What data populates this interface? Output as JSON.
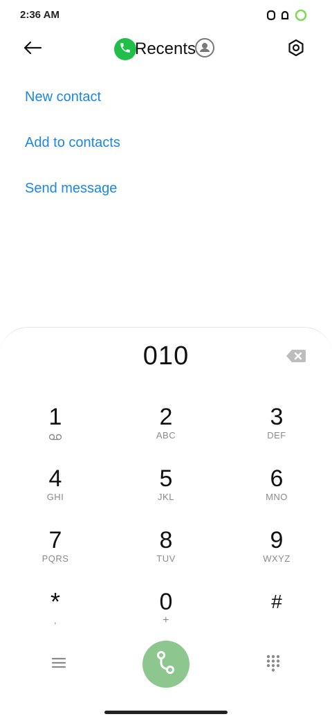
{
  "status_bar": {
    "time": "2:36 AM",
    "icons": [
      "notification-icon",
      "notification-icon",
      "battery-ring-icon"
    ]
  },
  "top_bar": {
    "back_icon": "arrow-left-icon",
    "tabs": {
      "phone_icon": "phone-icon",
      "recents_label": "Recents",
      "contacts_icon": "contacts-icon"
    },
    "settings_icon": "settings-icon"
  },
  "actions": [
    {
      "label": "New contact"
    },
    {
      "label": "Add to contacts"
    },
    {
      "label": "Send message"
    }
  ],
  "dialpad": {
    "number": "010",
    "keys": [
      {
        "digit": "1",
        "letters": "",
        "icon": "voicemail-icon"
      },
      {
        "digit": "2",
        "letters": "ABC"
      },
      {
        "digit": "3",
        "letters": "DEF"
      },
      {
        "digit": "4",
        "letters": "GHI"
      },
      {
        "digit": "5",
        "letters": "JKL"
      },
      {
        "digit": "6",
        "letters": "MNO"
      },
      {
        "digit": "7",
        "letters": "PQRS"
      },
      {
        "digit": "8",
        "letters": "TUV"
      },
      {
        "digit": "9",
        "letters": "WXYZ"
      },
      {
        "digit": "*",
        "letters": ","
      },
      {
        "digit": "0",
        "letters": "+"
      },
      {
        "digit": "#",
        "letters": ""
      }
    ]
  },
  "colors": {
    "accent_blue": "#1a86e6",
    "phone_green": "#1fbf4a",
    "call_button": "#8dc68e"
  }
}
